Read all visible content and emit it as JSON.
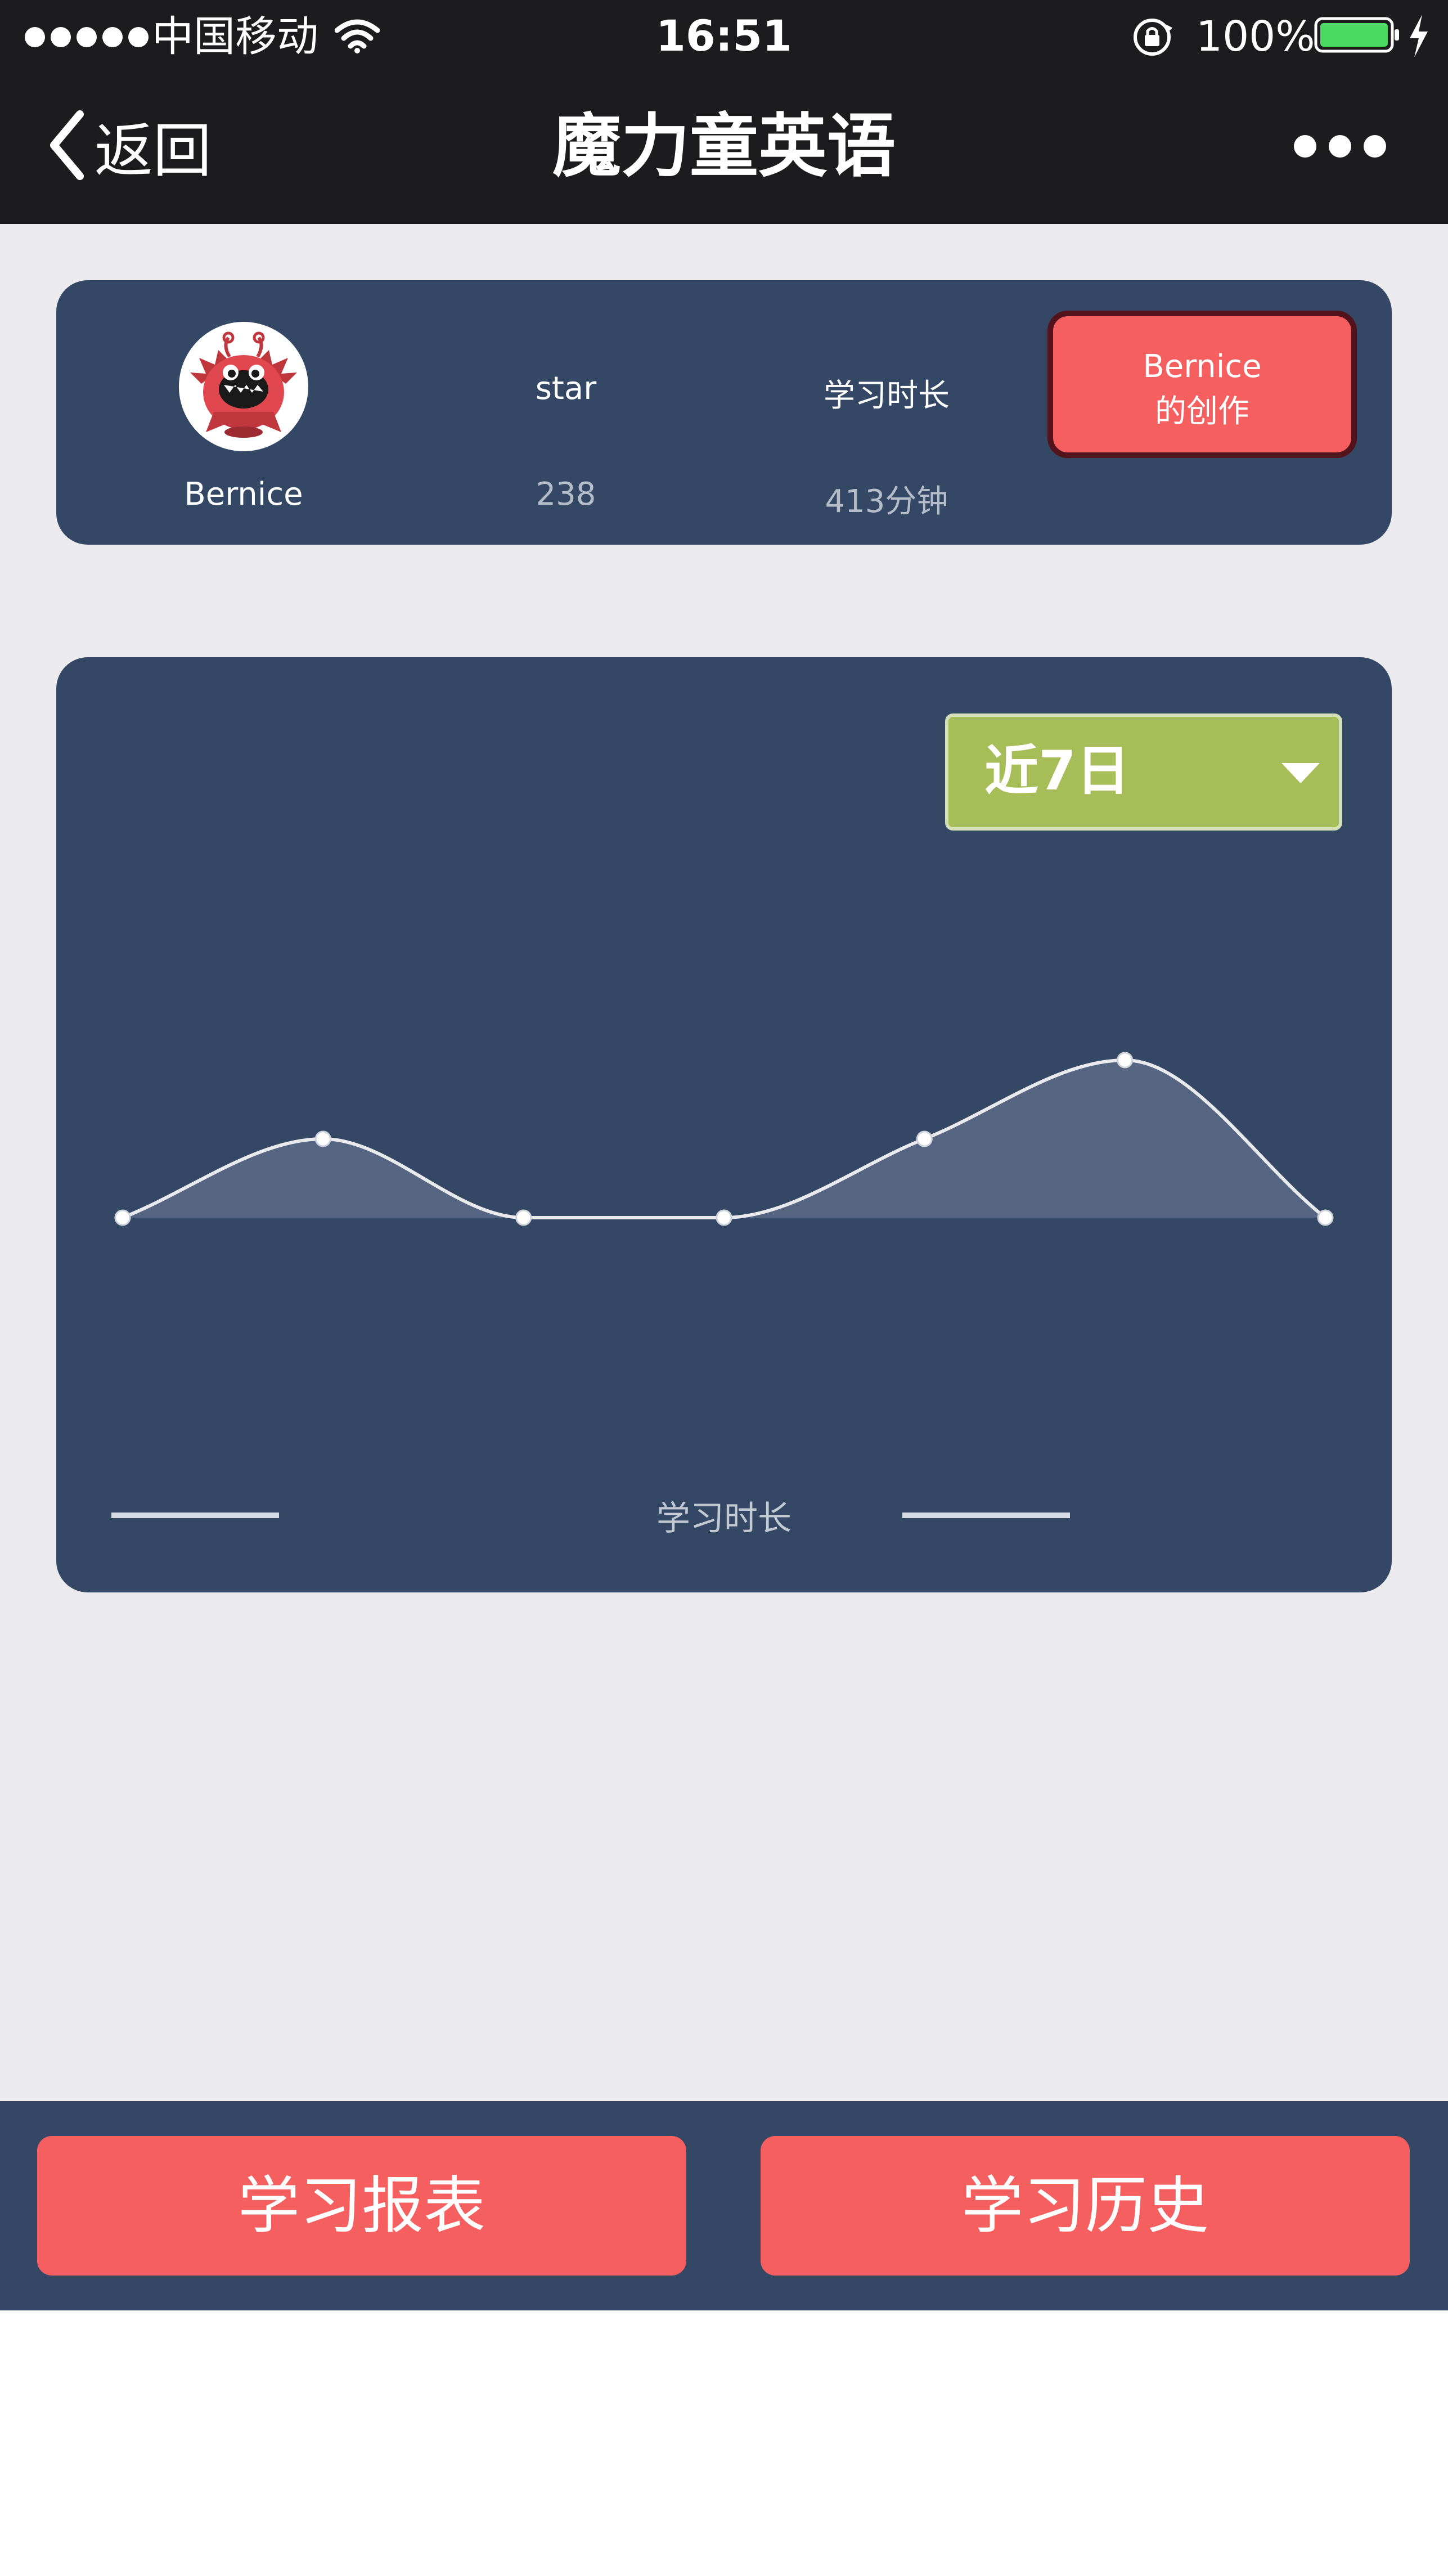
{
  "status_bar": {
    "carrier": "中国移动",
    "time": "16:51",
    "battery": "100%"
  },
  "nav": {
    "back_label": "返回",
    "title": "魔力童英语"
  },
  "profile": {
    "name": "Bernice",
    "star_label": "star",
    "star_value": "238",
    "study_time_label": "学习时长",
    "study_time_value": "413分钟",
    "works_button_line1": "Bernice",
    "works_button_line2": "的创作"
  },
  "chart": {
    "range_selected": "近7日",
    "legend_label": "学习时长"
  },
  "chart_data": {
    "type": "area",
    "title": "",
    "xlabel": "",
    "ylabel": "",
    "series": [
      {
        "name": "学习时长",
        "values": [
          0,
          0.5,
          0,
          0,
          0.5,
          1,
          0
        ]
      }
    ],
    "ylim": [
      0,
      1
    ],
    "grid": false,
    "legend_position": "bottom",
    "line_color": "#e8eaee",
    "fill_color": "#566581"
  },
  "actions": {
    "report_label": "学习报表",
    "history_label": "学习历史"
  },
  "colors": {
    "navy": "#344866",
    "accent_red": "#f65f5f",
    "accent_green": "#a7bd57",
    "status_bar": "#1c1c1f",
    "background": "#ebebef"
  }
}
